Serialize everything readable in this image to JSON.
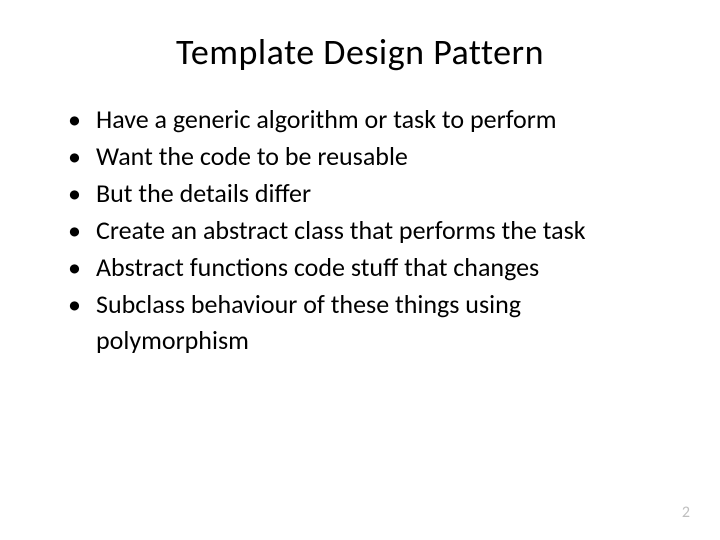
{
  "title": "Template Design Pattern",
  "bullets": [
    "Have a generic algorithm or task to perform",
    "Want the code to be reusable",
    "But the details differ",
    "Create an abstract class that performs the task",
    "Abstract functions code stuff that changes",
    "Subclass behaviour of these things using polymorphism"
  ],
  "pageNumber": "2"
}
